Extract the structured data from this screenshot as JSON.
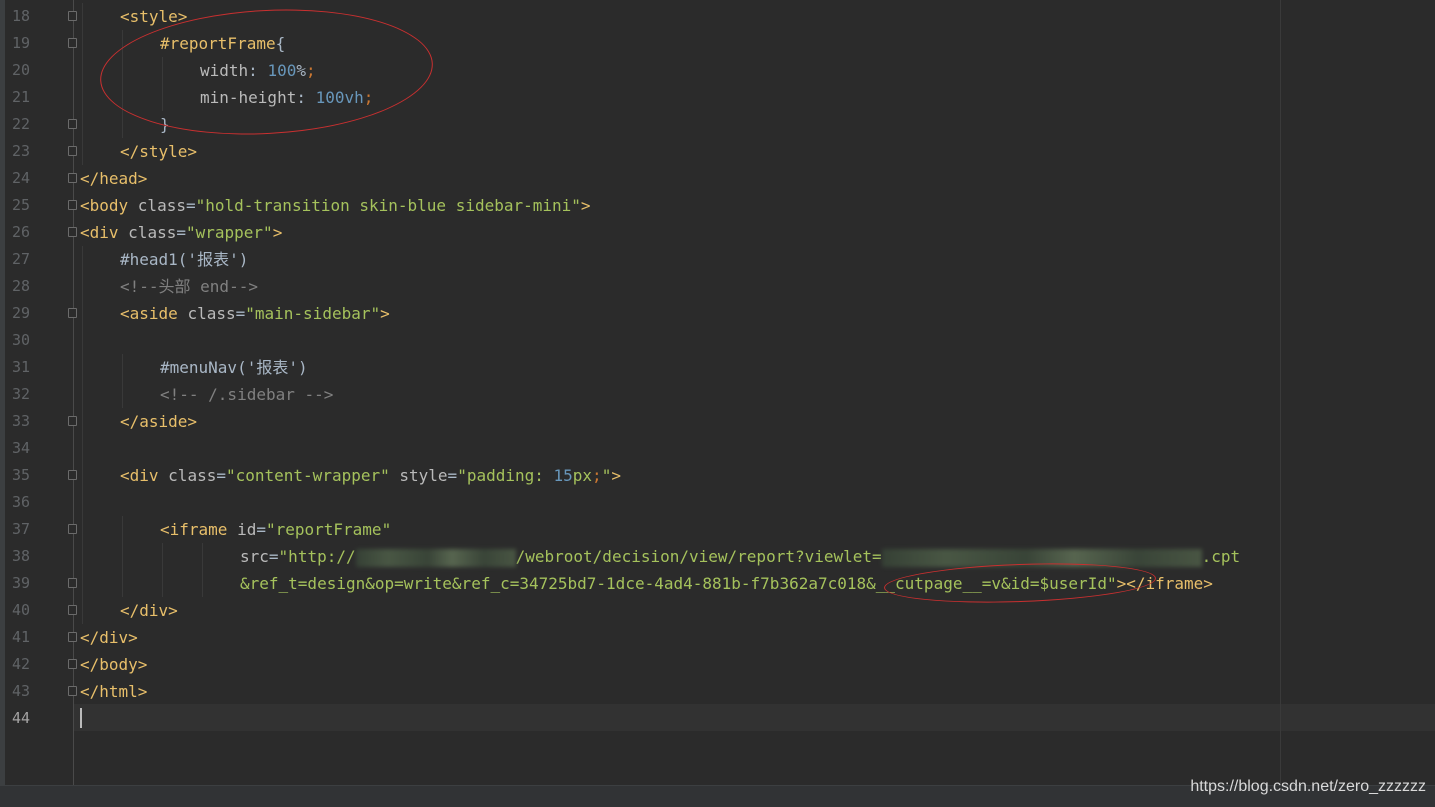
{
  "editor": {
    "lines": [
      {
        "num": "18",
        "segments": [
          [
            "tag",
            "<style>"
          ]
        ]
      },
      {
        "num": "19",
        "segments": [
          [
            "sel",
            "#reportFrame"
          ],
          [
            "text",
            "{"
          ]
        ]
      },
      {
        "num": "20",
        "segments": [
          [
            "prop",
            "width"
          ],
          [
            "text",
            ": "
          ],
          [
            "num",
            "100"
          ],
          [
            "text",
            "%"
          ],
          [
            "punct",
            ";"
          ]
        ]
      },
      {
        "num": "21",
        "segments": [
          [
            "prop",
            "min-height"
          ],
          [
            "text",
            ": "
          ],
          [
            "num",
            "100"
          ],
          [
            "num",
            "vh"
          ],
          [
            "punct",
            ";"
          ]
        ]
      },
      {
        "num": "22",
        "segments": [
          [
            "text",
            "}"
          ]
        ]
      },
      {
        "num": "23",
        "segments": [
          [
            "tag",
            "</style>"
          ]
        ]
      },
      {
        "num": "24",
        "segments": [
          [
            "tag",
            "</head>"
          ]
        ]
      },
      {
        "num": "25",
        "segments": [
          [
            "tag",
            "<body "
          ],
          [
            "attr",
            "class"
          ],
          [
            "text",
            "="
          ],
          [
            "str",
            "\"hold-transition skin-blue sidebar-mini\""
          ],
          [
            "tag",
            ">"
          ]
        ]
      },
      {
        "num": "26",
        "segments": [
          [
            "tag",
            "<div "
          ],
          [
            "attr",
            "class"
          ],
          [
            "text",
            "="
          ],
          [
            "str",
            "\"wrapper\""
          ],
          [
            "tag",
            ">"
          ]
        ]
      },
      {
        "num": "27",
        "segments": [
          [
            "text",
            "#head1('报表')"
          ]
        ]
      },
      {
        "num": "28",
        "segments": [
          [
            "comment",
            "<!--头部 end-->"
          ]
        ]
      },
      {
        "num": "29",
        "segments": [
          [
            "tag",
            "<aside "
          ],
          [
            "attr",
            "class"
          ],
          [
            "text",
            "="
          ],
          [
            "str",
            "\"main-sidebar\""
          ],
          [
            "tag",
            ">"
          ]
        ]
      },
      {
        "num": "30",
        "segments": []
      },
      {
        "num": "31",
        "segments": [
          [
            "text",
            "#menuNav('报表')"
          ]
        ]
      },
      {
        "num": "32",
        "segments": [
          [
            "comment",
            "<!-- /.sidebar -->"
          ]
        ]
      },
      {
        "num": "33",
        "segments": [
          [
            "tag",
            "</aside>"
          ]
        ]
      },
      {
        "num": "34",
        "segments": []
      },
      {
        "num": "35",
        "segments": [
          [
            "tag",
            "<div "
          ],
          [
            "attr",
            "class"
          ],
          [
            "text",
            "="
          ],
          [
            "str",
            "\"content-wrapper\""
          ],
          [
            "attr",
            " style"
          ],
          [
            "text",
            "="
          ],
          [
            "str",
            "\"padding: "
          ],
          [
            "num",
            "15"
          ],
          [
            "str",
            "px"
          ],
          [
            "punct",
            ";"
          ],
          [
            "str",
            "\""
          ],
          [
            "tag",
            ">"
          ]
        ]
      },
      {
        "num": "36",
        "segments": []
      },
      {
        "num": "37",
        "segments": [
          [
            "tag",
            "<iframe "
          ],
          [
            "attr",
            "id"
          ],
          [
            "text",
            "="
          ],
          [
            "str",
            "\"reportFrame\""
          ]
        ]
      },
      {
        "num": "38",
        "segments": [
          [
            "attr",
            "src"
          ],
          [
            "text",
            "="
          ],
          [
            "str",
            "\"http://"
          ],
          [
            "blur",
            "160"
          ],
          [
            "str",
            "/webroot/decision/view/report?viewlet="
          ],
          [
            "blur",
            "320"
          ],
          [
            "str",
            ".cpt"
          ]
        ]
      },
      {
        "num": "39",
        "segments": [
          [
            "str",
            "&ref_t=design&op=write&ref_c=34725bd7-1dce-4ad4-881b-f7b362a7c018&__cutpage__=v&id=$userId\""
          ],
          [
            "tag",
            "></iframe>"
          ]
        ]
      },
      {
        "num": "40",
        "segments": [
          [
            "tag",
            "</div>"
          ]
        ]
      },
      {
        "num": "41",
        "segments": [
          [
            "tag",
            "</div>"
          ]
        ]
      },
      {
        "num": "42",
        "segments": [
          [
            "tag",
            "</body>"
          ]
        ]
      },
      {
        "num": "43",
        "segments": [
          [
            "tag",
            "</html>"
          ]
        ]
      },
      {
        "num": "44",
        "segments": []
      }
    ],
    "active_line": "44"
  },
  "watermark": "https://blog.csdn.net/zero_zzzzzz",
  "colors": {
    "background": "#2b2b2b",
    "tag": "#e8bf6a",
    "string": "#a5c25c",
    "number": "#6897bb",
    "comment": "#808080",
    "annotation_circle": "#c93030"
  }
}
